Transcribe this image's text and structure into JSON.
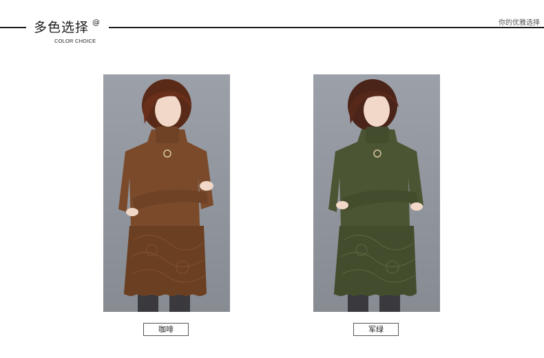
{
  "header": {
    "title": "多色选择",
    "at_symbol": "@",
    "subtitle": "COLOR CHOICE",
    "tagline": "你的优雅选择"
  },
  "products": [
    {
      "color_name": "咖啡",
      "garment_color": "#7a4a2b",
      "lace_color": "#6b3f22"
    },
    {
      "color_name": "军绿",
      "garment_color": "#4b5533",
      "lace_color": "#434c2c"
    }
  ]
}
